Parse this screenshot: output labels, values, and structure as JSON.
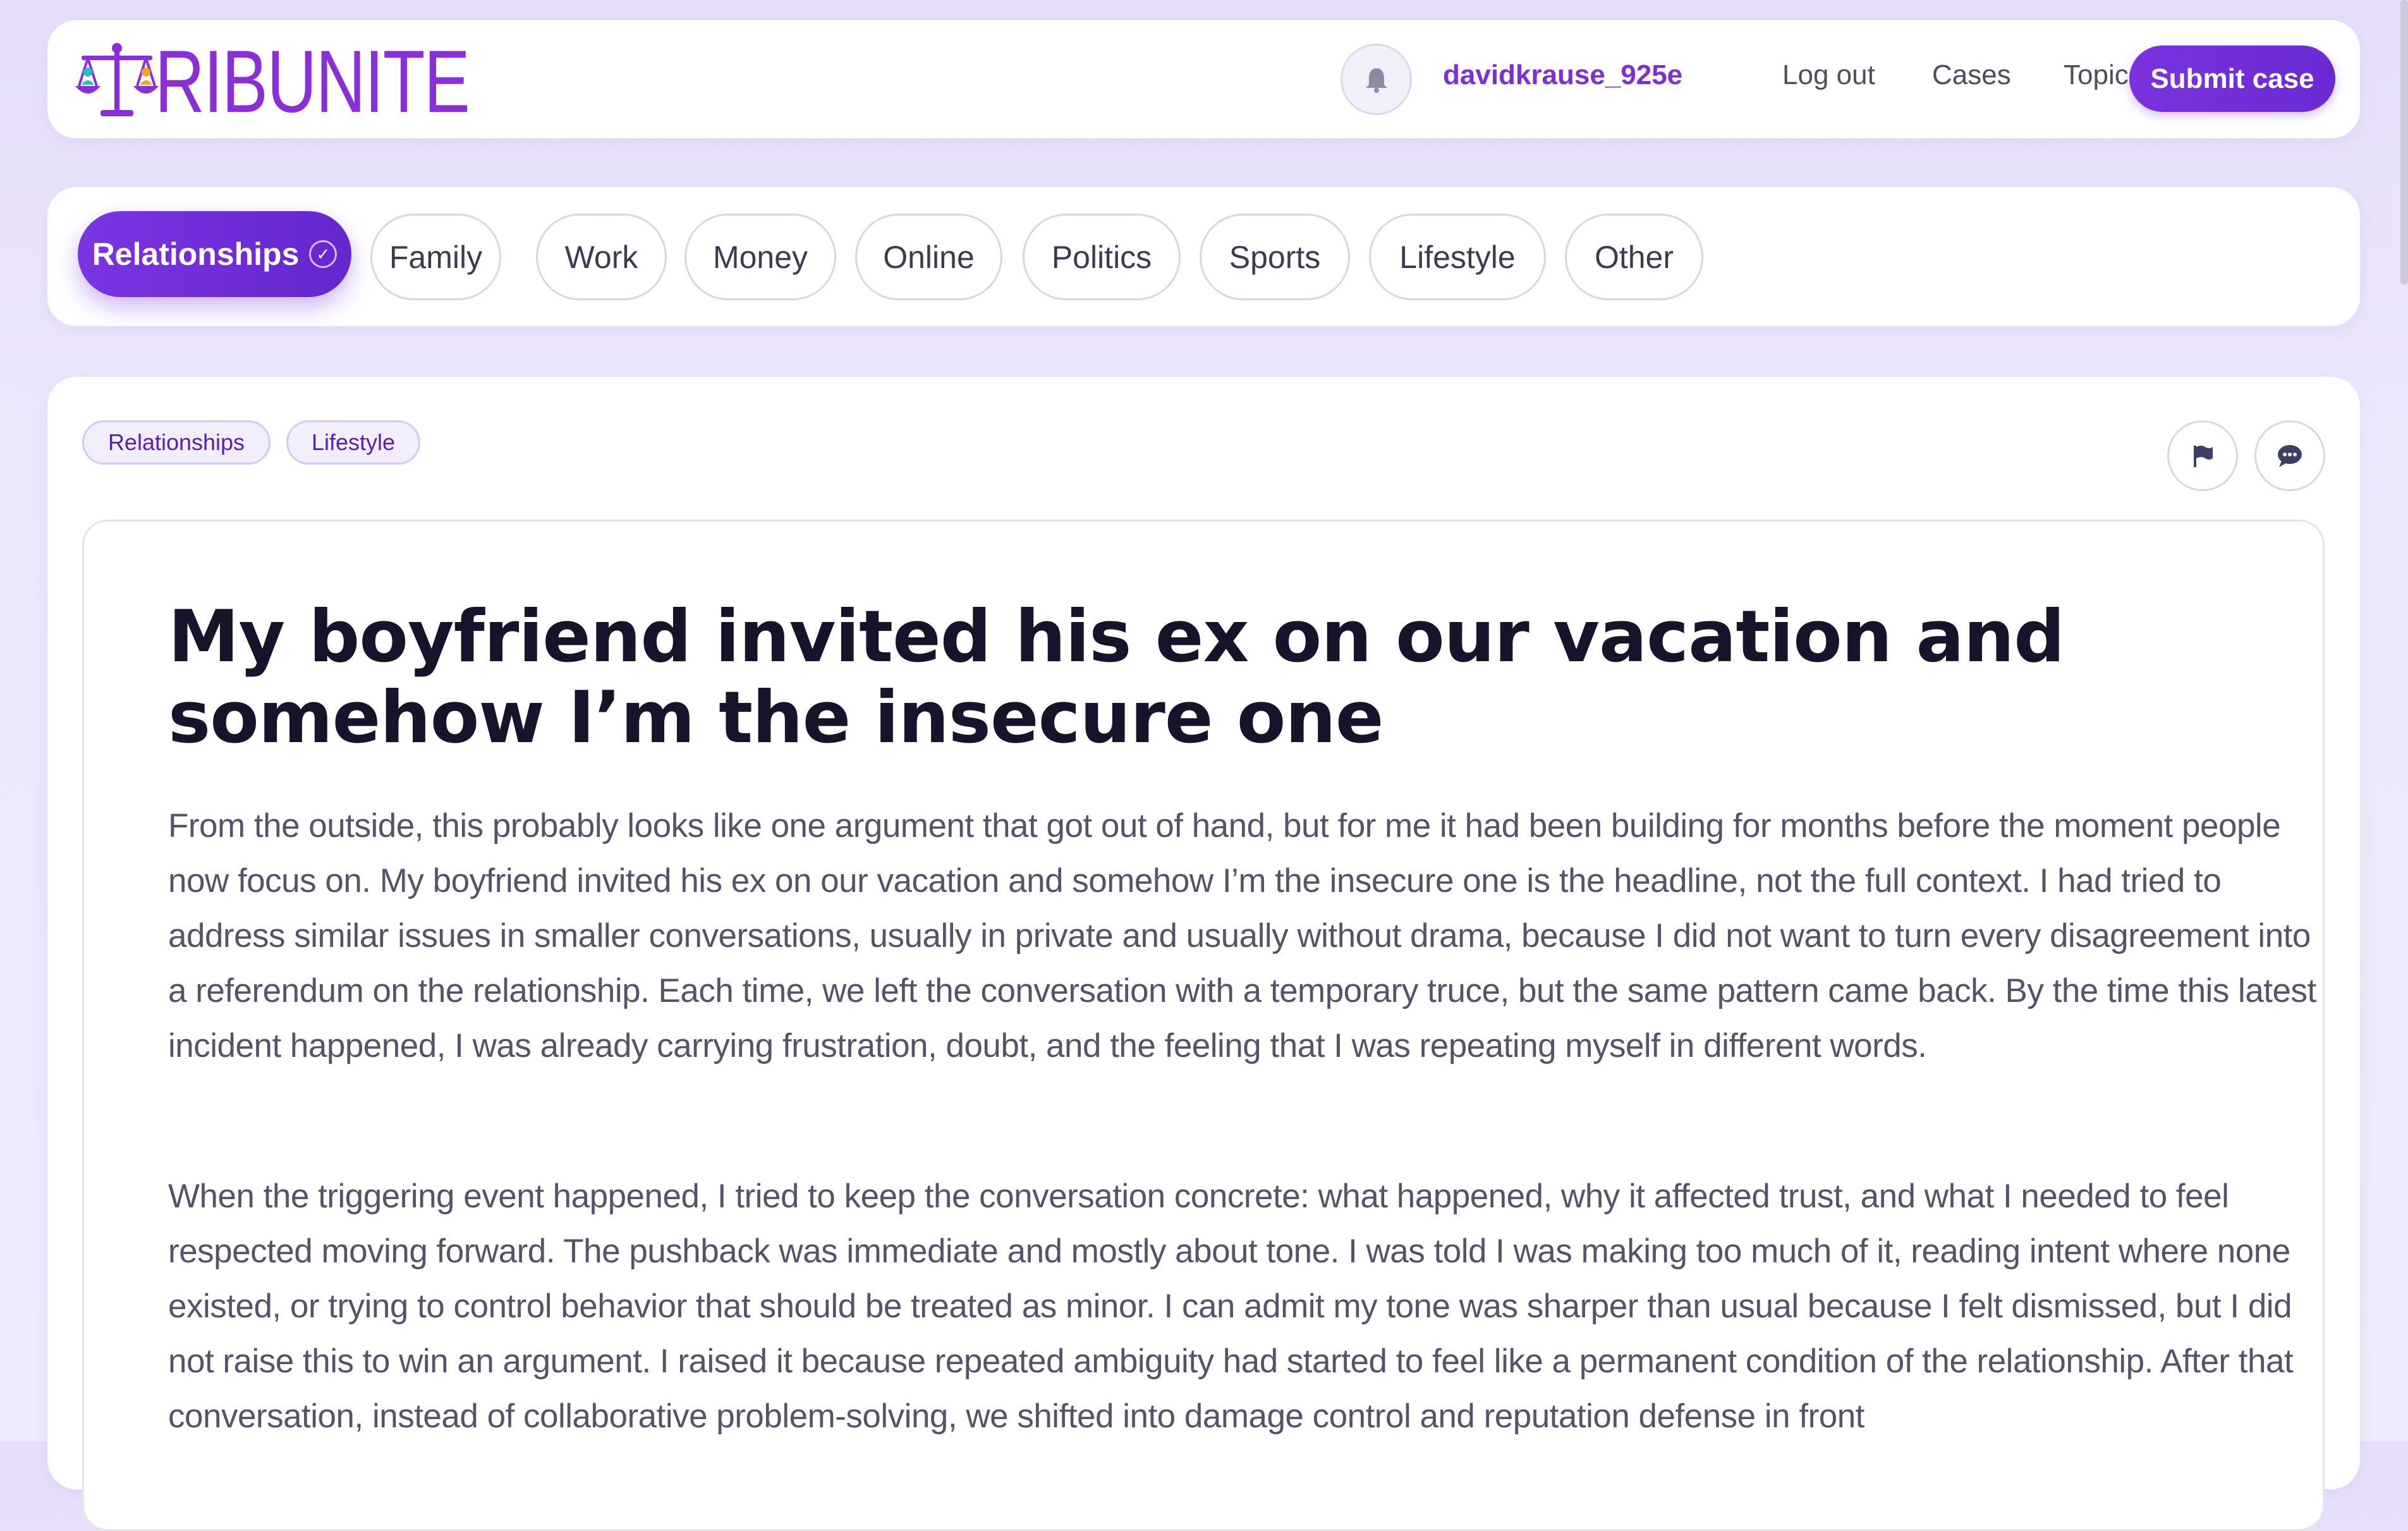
{
  "header": {
    "logo_text": "RIBUNITE",
    "logo_icon": "scales-of-justice-icon",
    "notification_icon": "bell-icon",
    "username": "davidkrause_925e",
    "logout_label": "Log out",
    "cases_label": "Cases",
    "topics_label": "Topics",
    "submit_label": "Submit case"
  },
  "categories": [
    {
      "label": "Relationships",
      "active": true
    },
    {
      "label": "Family",
      "active": false
    },
    {
      "label": "Work",
      "active": false
    },
    {
      "label": "Money",
      "active": false
    },
    {
      "label": "Online",
      "active": false
    },
    {
      "label": "Politics",
      "active": false
    },
    {
      "label": "Sports",
      "active": false
    },
    {
      "label": "Lifestyle",
      "active": false
    },
    {
      "label": "Other",
      "active": false
    }
  ],
  "active_check": "✓",
  "post": {
    "tags": [
      "Relationships",
      "Lifestyle"
    ],
    "actions": [
      {
        "icon": "flag-icon"
      },
      {
        "icon": "comment-icon"
      }
    ],
    "title": "My boyfriend invited his ex on our vacation and somehow I’m the insecure one",
    "paragraphs": [
      "From the outside, this probably looks like one argument that got out of hand, but for me it had been building for months before the moment people now focus on. My boyfriend invited his ex on our vacation and somehow I’m the insecure one is the headline, not the full context. I had tried to address similar issues in smaller conversations, usually in private and usually without drama, because I did not want to turn every disagreement into a referendum on the relationship. Each time, we left the conversation with a temporary truce, but the same pattern came back. By the time this latest incident happened, I was already carrying frustration, doubt, and the feeling that I was repeating myself in different words.",
      "When the triggering event happened, I tried to keep the conversation concrete: what happened, why it affected trust, and what I needed to feel respected moving forward. The pushback was immediate and mostly about tone. I was told I was making too much of it, reading intent where none existed, or trying to control behavior that should be treated as minor. I can admit my tone was sharper than usual because I felt dismissed, but I did not raise this to win an argument. I raised it because repeated ambiguity had started to feel like a permanent condition of the relationship. After that conversation, instead of collaborative problem-solving, we shifted into damage control and reputation defense in front"
    ]
  },
  "colors": {
    "accent": "#7b32e0",
    "logo": "#8a2fd8",
    "background": "#ebe4fb"
  }
}
